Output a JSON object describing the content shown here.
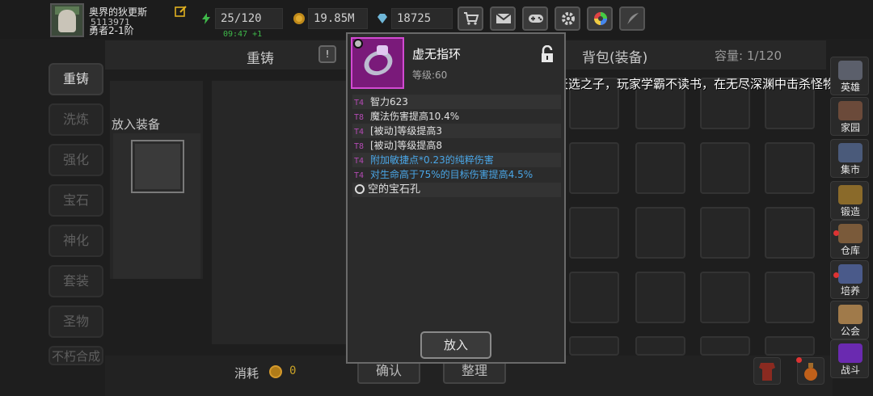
{
  "player": {
    "name": "奥界的狄更斯",
    "id": "5113971",
    "rank": "勇者2-1阶"
  },
  "resources": {
    "energy": "25/120",
    "energy_timer": "09:47 +1",
    "gold": "19.85M",
    "gems": "18725"
  },
  "toolbar_icons": [
    "shop-cart-icon",
    "mail-icon",
    "gamepad-icon",
    "settings-gear-icon",
    "color-wheel-icon",
    "quill-icon"
  ],
  "side_menu": [
    "重铸",
    "洗炼",
    "强化",
    "宝石",
    "神化",
    "套装",
    "圣物",
    "不朽合成"
  ],
  "forge": {
    "tab_title": "重铸",
    "hint": "!",
    "place_label": "放入装备",
    "cost_label": "消耗",
    "cost_value": "0",
    "confirm": "确认",
    "organize": "整理"
  },
  "backpack": {
    "title": "背包(装备)",
    "capacity": "容量: 1/120"
  },
  "marquee": "天选之子，玩家学霸不读书，在无尽深渊中击杀怪物获",
  "right_menu": [
    {
      "label": "英雄",
      "icon": "hero-icon",
      "color": "#5b5f6b"
    },
    {
      "label": "家园",
      "icon": "home-icon",
      "color": "#6b4a3a"
    },
    {
      "label": "集市",
      "icon": "market-icon",
      "color": "#4a5a7a"
    },
    {
      "label": "锻造",
      "icon": "anvil-icon",
      "color": "#8a6a2a"
    },
    {
      "label": "仓库",
      "icon": "warehouse-icon",
      "color": "#7a5a3a"
    },
    {
      "label": "培养",
      "icon": "training-icon",
      "color": "#4a5a8a"
    },
    {
      "label": "公会",
      "icon": "guild-icon",
      "color": "#a07a4a"
    },
    {
      "label": "战斗",
      "icon": "portal-icon",
      "color": "#6a2ab0"
    }
  ],
  "item": {
    "name": "虚无指环",
    "level": "等级:60",
    "stats": [
      {
        "tier": "T4",
        "text": "智力623",
        "style": "normal"
      },
      {
        "tier": "T8",
        "text": "魔法伤害提高10.4%",
        "style": "normal"
      },
      {
        "tier": "T4",
        "text": "[被动]等级提高3",
        "style": "normal"
      },
      {
        "tier": "T8",
        "text": "[被动]等级提高8",
        "style": "normal"
      },
      {
        "tier": "T4",
        "text": "附加敏捷点*0.23的纯粹伤害",
        "style": "blue"
      },
      {
        "tier": "T4",
        "text": "对生命高于75%的目标伤害提高4.5%",
        "style": "blue"
      }
    ],
    "socket": "空的宝石孔",
    "place_button": "放入"
  },
  "colors": {
    "rarity_border": "#d24ad2",
    "rarity_bg": "#7a1a7a",
    "tier": "#b34ab3",
    "blue_affix": "#4aa6e6",
    "timer": "#3fb94a"
  }
}
